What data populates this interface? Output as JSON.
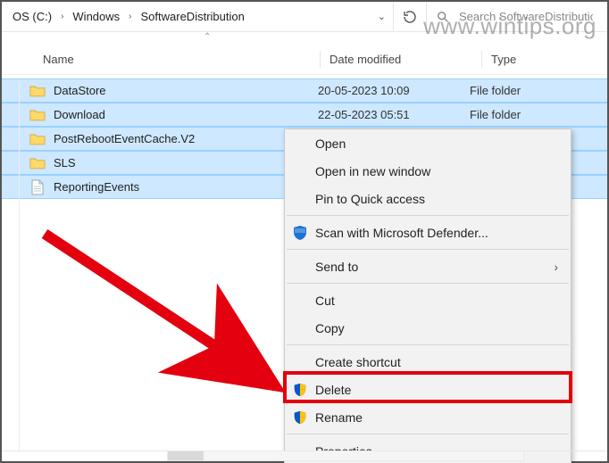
{
  "breadcrumb": {
    "parts": [
      "OS (C:)",
      "Windows",
      "SoftwareDistribution"
    ]
  },
  "search": {
    "placeholder": "Search SoftwareDistribution"
  },
  "columns": {
    "name": "Name",
    "date": "Date modified",
    "type": "Type"
  },
  "rows": [
    {
      "icon": "folder",
      "name": "DataStore",
      "date": "20-05-2023 10:09",
      "type": "File folder",
      "selected": true
    },
    {
      "icon": "folder",
      "name": "Download",
      "date": "22-05-2023 05:51",
      "type": "File folder",
      "selected": true
    },
    {
      "icon": "folder",
      "name": "PostRebootEventCache.V2",
      "date": "",
      "type": "",
      "selected": true
    },
    {
      "icon": "folder",
      "name": "SLS",
      "date": "",
      "type": "",
      "selected": true
    },
    {
      "icon": "file",
      "name": "ReportingEvents",
      "date": "",
      "type": "",
      "selected": true
    }
  ],
  "context_menu": {
    "open": "Open",
    "open_new_window": "Open in new window",
    "pin_quick": "Pin to Quick access",
    "defender": "Scan with Microsoft Defender...",
    "send_to": "Send to",
    "cut": "Cut",
    "copy": "Copy",
    "create_shortcut": "Create shortcut",
    "delete": "Delete",
    "rename": "Rename",
    "properties": "Properties"
  },
  "watermark": "www.wintips.org"
}
